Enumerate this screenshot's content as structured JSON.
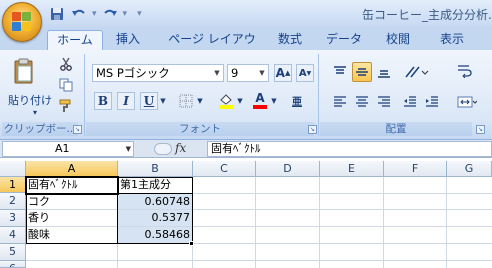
{
  "window": {
    "title": "缶コーヒー_主成分分析.xls"
  },
  "quick_access": {
    "save_icon": "save-icon",
    "undo_icon": "undo-icon",
    "redo_icon": "redo-icon"
  },
  "tabs": [
    "ホーム",
    "挿入",
    "ページ レイアウト",
    "数式",
    "データ",
    "校閲",
    "表示"
  ],
  "active_tab": "ホーム",
  "ribbon": {
    "clipboard": {
      "paste_label": "貼り付け",
      "group_label": "クリップボー..."
    },
    "font": {
      "font_name": "MS Pゴシック",
      "font_size": "9",
      "bold": "B",
      "italic": "I",
      "underline": "U",
      "font_color_letter": "A",
      "grow_letter": "A",
      "shrink_letter": "A",
      "phonetic_letter": "亜",
      "group_label": "フォント",
      "fill_color": "#ffff00",
      "font_color": "#ff0000"
    },
    "alignment": {
      "group_label": "配置"
    }
  },
  "formula_bar": {
    "name_box": "A1",
    "fx_label": "fx",
    "formula": "固有ﾍﾞｸﾄﾙ"
  },
  "grid": {
    "columns": [
      "A",
      "B",
      "C",
      "D",
      "E",
      "F",
      "G"
    ],
    "rows": [
      "1",
      "2",
      "3",
      "4",
      "5",
      "6"
    ],
    "selected_column": "A",
    "selected_row": "1"
  },
  "cells": {
    "A1": "固有ﾍﾞｸﾄﾙ",
    "B1": "第1主成分",
    "A2": "コク",
    "B2": "0.60748",
    "A3": "香り",
    "B3": "0.5377",
    "A4": "酸味",
    "B4": "0.58468"
  },
  "colors": {
    "ribbon_bg": "#dce8f7",
    "selected_header": "#f6c85c",
    "range_highlight": "#d6e3f2"
  }
}
